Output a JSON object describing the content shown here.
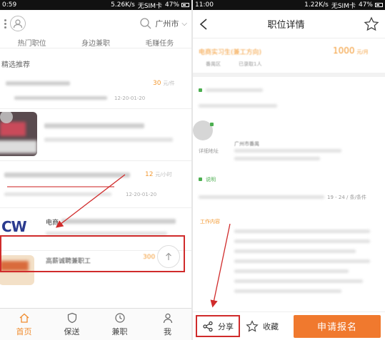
{
  "left": {
    "status": {
      "time": "0:59",
      "speed": "5.26K/s",
      "carrier": "无SIM卡",
      "battery": "47%"
    },
    "header": {
      "city": "广州市"
    },
    "tabs": [
      "热门职位",
      "身边兼职",
      "毛赚任务"
    ],
    "section_title": "精选推荐",
    "items": [
      {
        "price": "30",
        "unit": "元/件",
        "date": "12-20-01-20"
      },
      {
        "price": "12",
        "unit": "元/小时",
        "date": "12-20-01-20"
      },
      {
        "title": "电商",
        "logo": "CW"
      },
      {
        "title": "高薪诚聘兼职工",
        "price": "300"
      }
    ],
    "nav": [
      "首页",
      "保送",
      "兼职",
      "我"
    ]
  },
  "right": {
    "status": {
      "time": "11:00",
      "speed": "1.22K/s",
      "carrier": "无SIM卡",
      "battery": "47%"
    },
    "title": "职位详情",
    "job": {
      "title": "电商实习生(兼工方向)",
      "price": "1000",
      "unit": "元/月",
      "meta1": "番禺区",
      "meta2": "已录取1人"
    },
    "detail_label": "详细地址",
    "address": "广州市番禺",
    "section_a": "说明",
    "section_b": "工作内容",
    "range": "19 - 24 / 条/条件",
    "share_label": "分享",
    "fav_label": "收藏",
    "apply_label": "申请报名"
  },
  "colors": {
    "accent": "#f0792e",
    "highlight": "#d02b2b",
    "price": "#f39a33"
  }
}
